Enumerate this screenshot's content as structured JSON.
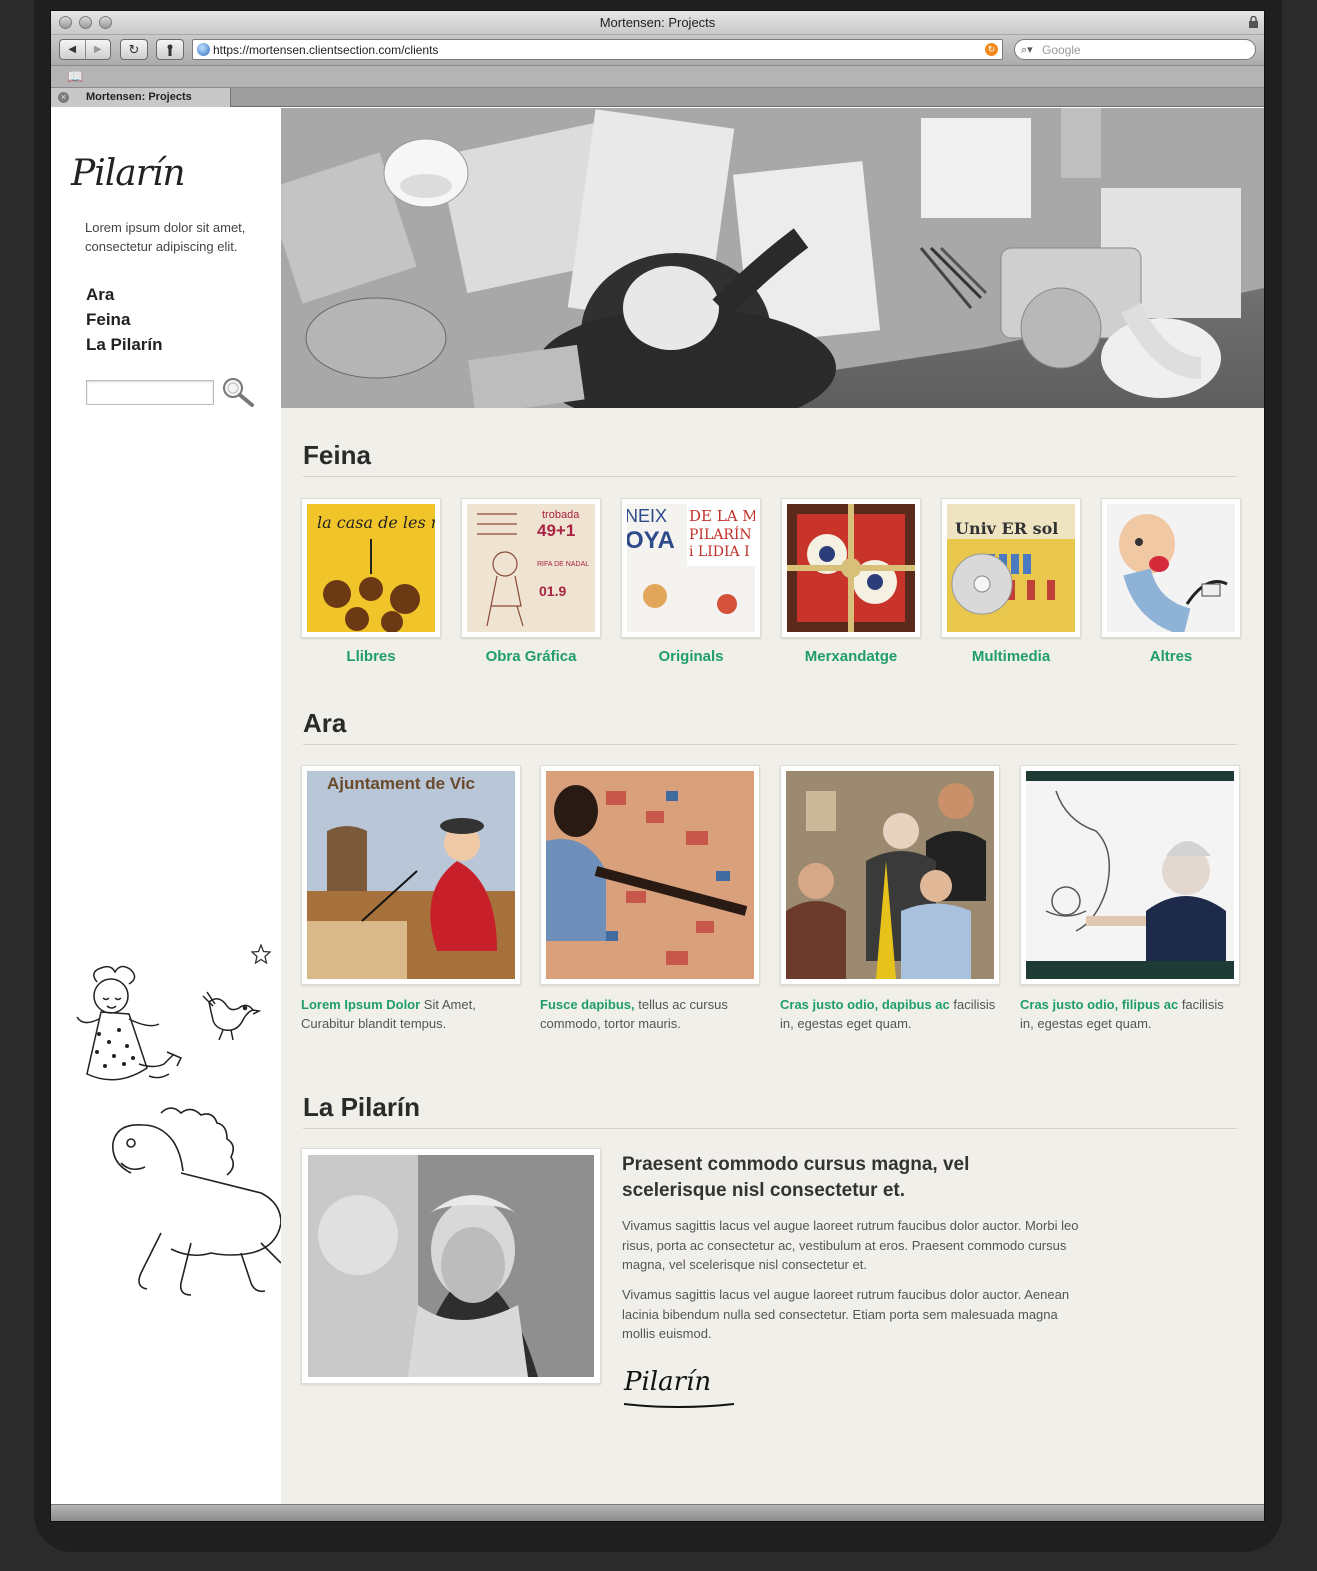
{
  "browser": {
    "window_title": "Mortensen: Projects",
    "url": "https://mortensen.clientsection.com/clients",
    "search_placeholder": "Google",
    "tab_title": "Mortensen: Projects"
  },
  "sidebar": {
    "logo_text": "Pilarín",
    "tagline": "Lorem ipsum dolor sit amet, consectetur adipiscing elit.",
    "nav": [
      {
        "label": "Ara"
      },
      {
        "label": "Feina"
      },
      {
        "label": "La Pilarín"
      }
    ]
  },
  "feina": {
    "title": "Feina",
    "categories": [
      {
        "label": "Llibres"
      },
      {
        "label": "Obra Gráfica"
      },
      {
        "label": "Originals"
      },
      {
        "label": "Merxandatge"
      },
      {
        "label": "Multimedia"
      },
      {
        "label": "Altres"
      }
    ],
    "thumb_text": {
      "llibres_cover": "la casa de les mones",
      "obra_line1": "trobada",
      "obra_line2": "49+1",
      "obra_line3": "RIFA DE NADAL",
      "obra_line4": "01.9",
      "originals_left": "NEIX",
      "originals_left2": "OYA",
      "originals_right": "DE LA M",
      "originals_right2": "PILARÍN",
      "originals_right3": "i LIDIA I",
      "multimedia_title": "Univ ER sol"
    }
  },
  "ara": {
    "title": "Ara",
    "items": [
      {
        "highlight": "Lorem Ipsum Dolor",
        "text": " Sit Amet, Curabitur blandit tempus."
      },
      {
        "highlight": "Fusce dapibus,",
        "text": " tellus ac cursus commodo, tortor mauris."
      },
      {
        "highlight": "Cras justo odio, dapibus ac",
        "text": " facilisis in, egestas eget quam."
      },
      {
        "highlight": "Cras justo odio, filipus ac",
        "text": " facilisis in, egestas eget quam."
      }
    ],
    "photo_sign": "Ajuntament de Vic"
  },
  "bio": {
    "title": "La Pilarín",
    "heading": "Praesent commodo cursus magna, vel scelerisque nisl consectetur et.",
    "paragraphs": [
      "Vivamus sagittis lacus vel augue laoreet rutrum faucibus dolor auctor. Morbi leo risus, porta ac consectetur ac, vestibulum at eros. Praesent commodo cursus magna, vel scelerisque nisl consectetur et.",
      "Vivamus sagittis lacus vel augue laoreet rutrum faucibus dolor auctor. Aenean lacinia bibendum nulla sed consectetur. Etiam porta sem malesuada magna mollis euismod."
    ],
    "signature": "Pilarín"
  },
  "colors": {
    "accent_green": "#1f9e68",
    "paper": "#f1efe9"
  }
}
